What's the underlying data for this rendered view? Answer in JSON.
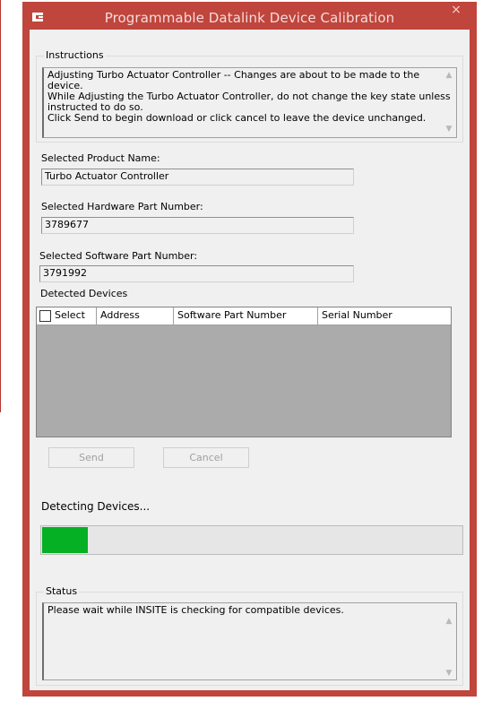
{
  "window": {
    "title": "Programmable Datalink Device Calibration",
    "close_glyph": "×",
    "accent": "#c0453c",
    "logo_icon": "cummins-logo"
  },
  "instructions": {
    "legend": "Instructions",
    "lines": [
      "Adjusting Turbo Actuator Controller -- Changes are about to be made to the device.",
      "While Adjusting the Turbo Actuator Controller, do not change the key state unless",
      "instructed to do so.",
      "Click Send to begin download or click cancel to leave the device unchanged."
    ]
  },
  "product": {
    "label": "Selected Product Name:",
    "value": "Turbo Actuator Controller"
  },
  "hardware": {
    "label": "Selected Hardware Part Number:",
    "value": "3789677"
  },
  "software": {
    "label": "Selected Software Part Number:",
    "value": "3791992"
  },
  "devices": {
    "legend": "Detected Devices",
    "columns": [
      "Select",
      "Address",
      "Software Part Number",
      "Serial Number"
    ]
  },
  "buttons": {
    "send": "Send",
    "cancel": "Cancel"
  },
  "progress": {
    "label": "Detecting Devices...",
    "fraction": 0.11,
    "color": "#06b025"
  },
  "status": {
    "legend": "Status",
    "text": "Please wait while INSITE is checking for compatible devices."
  }
}
